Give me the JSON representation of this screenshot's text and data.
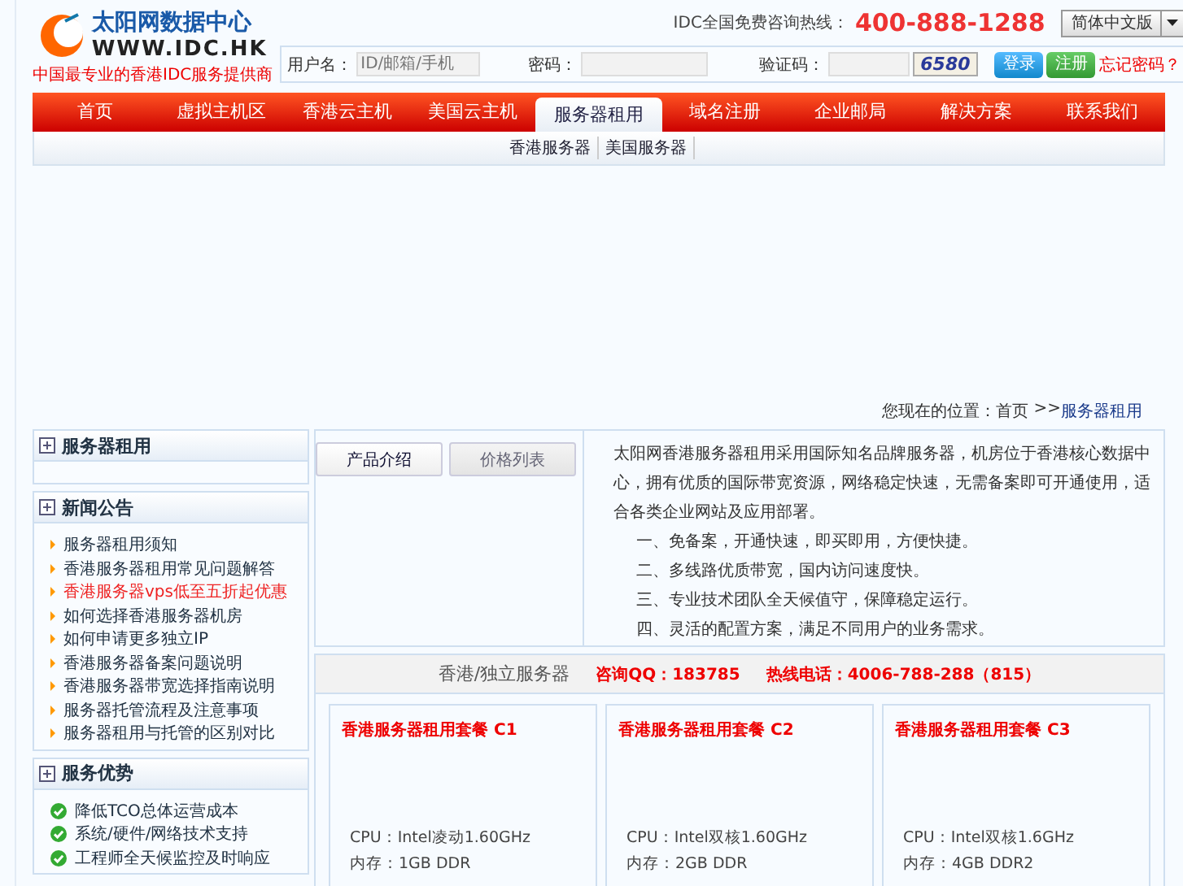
{
  "header": {
    "logo_text": "太阳网数据中心",
    "logo_url": "WWW.IDC.HK",
    "slogan": "中国最专业的香港IDC服务提供商",
    "hotline_label": "IDC全国免费咨询热线：",
    "hotline": "400-888-1288",
    "language": "简体中文版"
  },
  "login": {
    "user_label": "用户名：",
    "user_placeholder": "ID/邮箱/手机",
    "password_label": "密码：",
    "code_label": "验证码：",
    "captcha": "6580",
    "login_button": "登录",
    "register_button": "注册",
    "forgot": "忘记密码？"
  },
  "nav": [
    {
      "label": "首页",
      "selected": false
    },
    {
      "label": "虚拟主机区",
      "selected": false
    },
    {
      "label": "香港云主机",
      "selected": false
    },
    {
      "label": "美国云主机",
      "selected": false
    },
    {
      "label": "服务器租用",
      "selected": true
    },
    {
      "label": "域名注册",
      "selected": false
    },
    {
      "label": "企业邮局",
      "selected": false
    },
    {
      "label": "解决方案",
      "selected": false
    },
    {
      "label": "联系我们",
      "selected": false
    }
  ],
  "subnav": [
    "香港服务器",
    "美国服务器"
  ],
  "breadcrumb": {
    "prefix": "您现在的位置：",
    "home": "首页",
    "separator": ">>",
    "current": "服务器租用"
  },
  "sidebar": [
    {
      "kind": "empty",
      "title": "服务器租用"
    },
    {
      "kind": "news",
      "title": "新闻公告",
      "items": [
        {
          "text": "服务器租用须知",
          "highlight": false
        },
        {
          "text": "香港服务器租用常见问题解答",
          "highlight": false
        },
        {
          "text": "香港服务器vps低至五折起优惠",
          "highlight": true
        },
        {
          "text": "如何选择香港服务器机房",
          "highlight": false
        },
        {
          "text": "如何申请更多独立IP",
          "highlight": false
        },
        {
          "text": "香港服务器备案问题说明",
          "highlight": false
        },
        {
          "text": "香港服务器带宽选择指南说明",
          "highlight": false
        },
        {
          "text": "服务器托管流程及注意事项",
          "highlight": false
        },
        {
          "text": "服务器租用与托管的区别对比",
          "highlight": false
        }
      ]
    },
    {
      "kind": "check",
      "title": "服务优势",
      "items": [
        {
          "text": "降低TCO总体运营成本",
          "highlight": false
        },
        {
          "text": "系统/硬件/网络技术支持",
          "highlight": false
        },
        {
          "text": "工程师全天候监控及时响应",
          "highlight": false
        }
      ]
    }
  ],
  "tabs": [
    {
      "label": "产品介绍",
      "selected": true
    },
    {
      "label": "价格列表",
      "selected": false
    }
  ],
  "intro": {
    "paragraph": "太阳网香港服务器租用采用国际知名品牌服务器，机房位于香港核心数据中心，拥有优质的国际带宽资源，网络稳定快速，无需备案即可开通使用，适合各类企业网站及应用部署。",
    "points": [
      "一、免备案，开通快速，即买即用，方便快捷。",
      "二、多线路优质带宽，国内访问速度快。",
      "三、专业技术团队全天候值守，保障稳定运行。",
      "四、灵活的配置方案，满足不同用户的业务需求。"
    ]
  },
  "products": {
    "title": "香港/独立服务器",
    "qq": "咨询QQ：183785",
    "phone": "热线电话：4006-788-288（815）",
    "cards": [
      {
        "name": "香港服务器租用套餐 C1",
        "specs": [
          "CPU：Intel凌动1.60GHz",
          "内存：1GB DDR"
        ]
      },
      {
        "name": "香港服务器租用套餐 C2",
        "specs": [
          "CPU：Intel双核1.60GHz",
          "内存：2GB DDR"
        ]
      },
      {
        "name": "香港服务器租用套餐 C3",
        "specs": [
          "CPU：Intel双核1.6GHz",
          "内存：4GB DDR2"
        ]
      }
    ]
  }
}
